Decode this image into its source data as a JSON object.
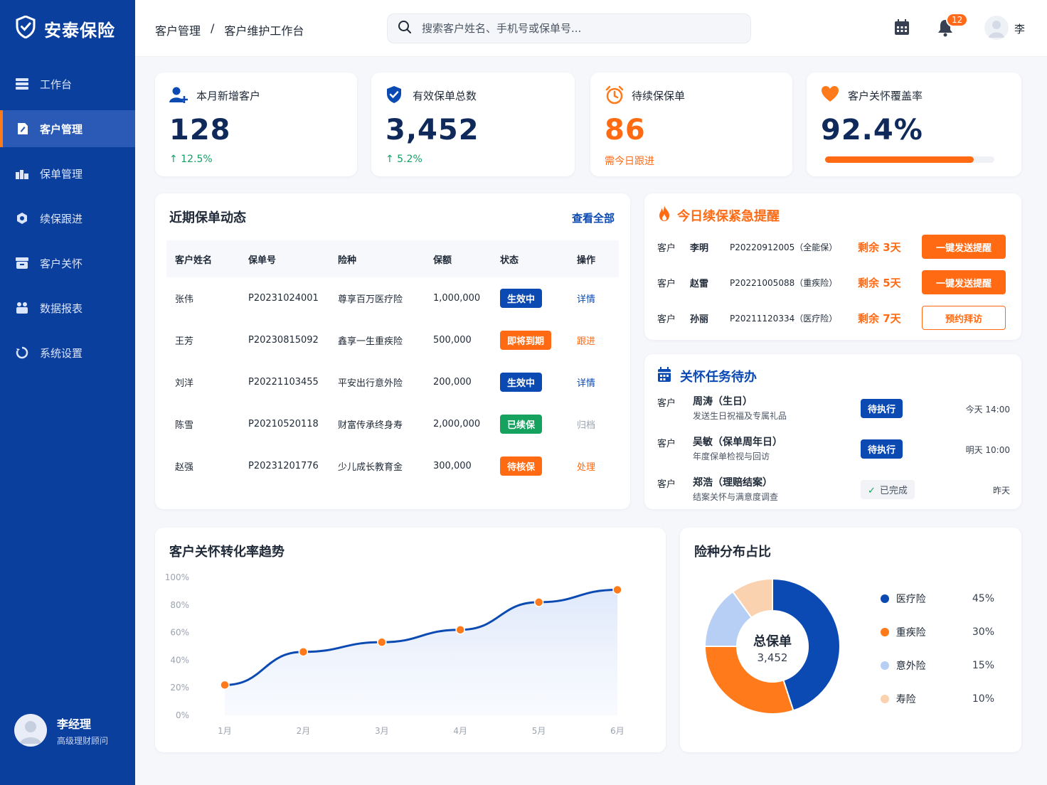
{
  "app": {
    "name": "安泰保险"
  },
  "sidebar": {
    "items": [
      {
        "label": "工作台",
        "icon": "dashboard-icon"
      },
      {
        "label": "客户管理",
        "icon": "customer-icon"
      },
      {
        "label": "保单管理",
        "icon": "policy-icon"
      },
      {
        "label": "续保跟进",
        "icon": "renewal-icon"
      },
      {
        "label": "客户关怀",
        "icon": "care-icon"
      },
      {
        "label": "数据报表",
        "icon": "report-icon"
      },
      {
        "label": "系统设置",
        "icon": "settings-icon"
      }
    ],
    "active_index": 1,
    "profile": {
      "name": "李经理",
      "role": "高级理财顾问"
    }
  },
  "header": {
    "breadcrumb": [
      "客户管理",
      "/",
      "客户维护工作台"
    ],
    "search_placeholder": "搜索客户姓名、手机号或保单号...",
    "notification_count": "12",
    "user": "李"
  },
  "stats": [
    {
      "title": "本月新增客户",
      "value": "128",
      "sub": "↑ 12.5%",
      "icon": "add-user-icon"
    },
    {
      "title": "有效保单总数",
      "value": "3,452",
      "sub": "↑ 5.2%",
      "icon": "shield-icon"
    },
    {
      "title": "待续保保单",
      "value": "86",
      "sub": "需今日跟进",
      "icon": "alarm-icon"
    },
    {
      "title": "客户关怀覆盖率",
      "value": "92.4%",
      "progress": 0.88,
      "icon": "heart-icon"
    }
  ],
  "recent": {
    "title": "近期保单动态",
    "link": "查看全部",
    "columns": [
      "客户姓名",
      "保单号",
      "险种",
      "保额",
      "状态",
      "操作"
    ],
    "rows": [
      {
        "name": "张伟",
        "no": "P20231024001",
        "type": "尊享百万医疗险",
        "amount": "1,000,000",
        "status": "生效中",
        "status_color": "#0b4ab3",
        "op": "详情",
        "op_color": "#0b4ab3"
      },
      {
        "name": "王芳",
        "no": "P20230815092",
        "type": "鑫享一生重疾险",
        "amount": "500,000",
        "status": "即将到期",
        "status_color": "#ff6a13",
        "op": "跟进",
        "op_color": "#ff6a13"
      },
      {
        "name": "刘洋",
        "no": "P20221103455",
        "type": "平安出行意外险",
        "amount": "200,000",
        "status": "生效中",
        "status_color": "#0b4ab3",
        "op": "详情",
        "op_color": "#0b4ab3"
      },
      {
        "name": "陈雪",
        "no": "P20210520118",
        "type": "财富传承终身寿",
        "amount": "2,000,000",
        "status": "已续保",
        "status_color": "#15a15e",
        "op": "归档",
        "op_color": "#9ca3af"
      },
      {
        "name": "赵强",
        "no": "P20231201776",
        "type": "少儿成长教育金",
        "amount": "300,000",
        "status": "待核保",
        "status_color": "#ff6a13",
        "op": "处理",
        "op_color": "#ff6a13"
      }
    ]
  },
  "urgent": {
    "title": "今日续保紧急提醒",
    "rows": [
      {
        "prefix": "客户",
        "name": "李明",
        "policy": "P20220912005（全能保）",
        "remain": "剩余 3天",
        "action": "一键发送提醒",
        "style": "solid"
      },
      {
        "prefix": "客户",
        "name": "赵雷",
        "policy": "P20221005088（重疾险）",
        "remain": "剩余 5天",
        "action": "一键发送提醒",
        "style": "solid"
      },
      {
        "prefix": "客户",
        "name": "孙丽",
        "policy": "P20211120334（医疗险）",
        "remain": "剩余 7天",
        "action": "预约拜访",
        "style": "outline"
      }
    ]
  },
  "tasks": {
    "title": "关怀任务待办",
    "rows": [
      {
        "prefix": "客户",
        "title": "周涛（生日）",
        "desc": "发送生日祝福及专属礼品",
        "status": "待执行",
        "done": false,
        "time": "今天 14:00"
      },
      {
        "prefix": "客户",
        "title": "吴敏（保单周年日）",
        "desc": "年度保单检视与回访",
        "status": "待执行",
        "done": false,
        "time": "明天 10:00"
      },
      {
        "prefix": "客户",
        "title": "郑浩（理赔结案）",
        "desc": "结案关怀与满意度调查",
        "status": "已完成",
        "done": true,
        "time": "昨天"
      }
    ]
  },
  "trend": {
    "title": "客户关怀转化率趋势"
  },
  "dist": {
    "title": "险种分布占比",
    "center_label": "总保单",
    "center_value": "3,452"
  },
  "chart_data": [
    {
      "type": "area",
      "title": "客户关怀转化率趋势",
      "categories": [
        "1月",
        "2月",
        "3月",
        "4月",
        "5月",
        "6月"
      ],
      "values": [
        22,
        46,
        53,
        62,
        82,
        91
      ],
      "y_ticks": [
        "100%",
        "80%",
        "60%",
        "40%",
        "20%",
        "0%"
      ],
      "ylim": [
        0,
        100
      ],
      "colors": {
        "line": "#0b4ab3",
        "point": "#ff7a1a"
      }
    },
    {
      "type": "pie",
      "title": "险种分布占比",
      "labels": [
        "医疗险",
        "重疾险",
        "意外险",
        "寿险"
      ],
      "values": [
        45,
        30,
        15,
        10
      ],
      "display": [
        "45%",
        "30%",
        "15%",
        "10%"
      ],
      "colors": [
        "#0b4ab3",
        "#ff7a1a",
        "#b7cff4",
        "#fbd2b0"
      ]
    }
  ]
}
